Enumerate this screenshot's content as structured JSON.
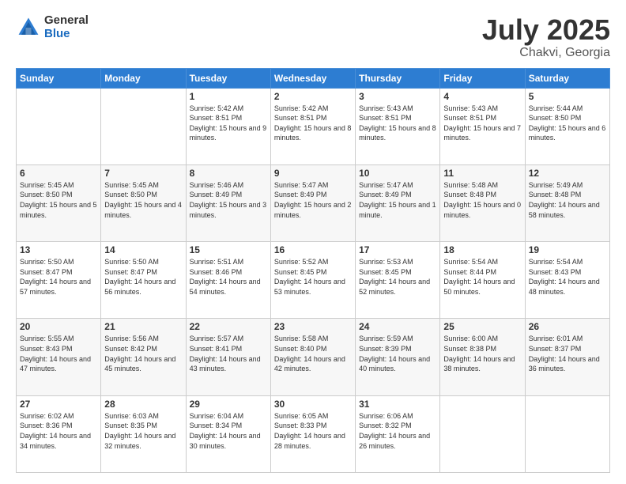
{
  "logo": {
    "general": "General",
    "blue": "Blue"
  },
  "header": {
    "month": "July 2025",
    "location": "Chakvi, Georgia"
  },
  "weekdays": [
    "Sunday",
    "Monday",
    "Tuesday",
    "Wednesday",
    "Thursday",
    "Friday",
    "Saturday"
  ],
  "weeks": [
    [
      {
        "day": "",
        "sunrise": "",
        "sunset": "",
        "daylight": ""
      },
      {
        "day": "",
        "sunrise": "",
        "sunset": "",
        "daylight": ""
      },
      {
        "day": "1",
        "sunrise": "Sunrise: 5:42 AM",
        "sunset": "Sunset: 8:51 PM",
        "daylight": "Daylight: 15 hours and 9 minutes."
      },
      {
        "day": "2",
        "sunrise": "Sunrise: 5:42 AM",
        "sunset": "Sunset: 8:51 PM",
        "daylight": "Daylight: 15 hours and 8 minutes."
      },
      {
        "day": "3",
        "sunrise": "Sunrise: 5:43 AM",
        "sunset": "Sunset: 8:51 PM",
        "daylight": "Daylight: 15 hours and 8 minutes."
      },
      {
        "day": "4",
        "sunrise": "Sunrise: 5:43 AM",
        "sunset": "Sunset: 8:51 PM",
        "daylight": "Daylight: 15 hours and 7 minutes."
      },
      {
        "day": "5",
        "sunrise": "Sunrise: 5:44 AM",
        "sunset": "Sunset: 8:50 PM",
        "daylight": "Daylight: 15 hours and 6 minutes."
      }
    ],
    [
      {
        "day": "6",
        "sunrise": "Sunrise: 5:45 AM",
        "sunset": "Sunset: 8:50 PM",
        "daylight": "Daylight: 15 hours and 5 minutes."
      },
      {
        "day": "7",
        "sunrise": "Sunrise: 5:45 AM",
        "sunset": "Sunset: 8:50 PM",
        "daylight": "Daylight: 15 hours and 4 minutes."
      },
      {
        "day": "8",
        "sunrise": "Sunrise: 5:46 AM",
        "sunset": "Sunset: 8:49 PM",
        "daylight": "Daylight: 15 hours and 3 minutes."
      },
      {
        "day": "9",
        "sunrise": "Sunrise: 5:47 AM",
        "sunset": "Sunset: 8:49 PM",
        "daylight": "Daylight: 15 hours and 2 minutes."
      },
      {
        "day": "10",
        "sunrise": "Sunrise: 5:47 AM",
        "sunset": "Sunset: 8:49 PM",
        "daylight": "Daylight: 15 hours and 1 minute."
      },
      {
        "day": "11",
        "sunrise": "Sunrise: 5:48 AM",
        "sunset": "Sunset: 8:48 PM",
        "daylight": "Daylight: 15 hours and 0 minutes."
      },
      {
        "day": "12",
        "sunrise": "Sunrise: 5:49 AM",
        "sunset": "Sunset: 8:48 PM",
        "daylight": "Daylight: 14 hours and 58 minutes."
      }
    ],
    [
      {
        "day": "13",
        "sunrise": "Sunrise: 5:50 AM",
        "sunset": "Sunset: 8:47 PM",
        "daylight": "Daylight: 14 hours and 57 minutes."
      },
      {
        "day": "14",
        "sunrise": "Sunrise: 5:50 AM",
        "sunset": "Sunset: 8:47 PM",
        "daylight": "Daylight: 14 hours and 56 minutes."
      },
      {
        "day": "15",
        "sunrise": "Sunrise: 5:51 AM",
        "sunset": "Sunset: 8:46 PM",
        "daylight": "Daylight: 14 hours and 54 minutes."
      },
      {
        "day": "16",
        "sunrise": "Sunrise: 5:52 AM",
        "sunset": "Sunset: 8:45 PM",
        "daylight": "Daylight: 14 hours and 53 minutes."
      },
      {
        "day": "17",
        "sunrise": "Sunrise: 5:53 AM",
        "sunset": "Sunset: 8:45 PM",
        "daylight": "Daylight: 14 hours and 52 minutes."
      },
      {
        "day": "18",
        "sunrise": "Sunrise: 5:54 AM",
        "sunset": "Sunset: 8:44 PM",
        "daylight": "Daylight: 14 hours and 50 minutes."
      },
      {
        "day": "19",
        "sunrise": "Sunrise: 5:54 AM",
        "sunset": "Sunset: 8:43 PM",
        "daylight": "Daylight: 14 hours and 48 minutes."
      }
    ],
    [
      {
        "day": "20",
        "sunrise": "Sunrise: 5:55 AM",
        "sunset": "Sunset: 8:43 PM",
        "daylight": "Daylight: 14 hours and 47 minutes."
      },
      {
        "day": "21",
        "sunrise": "Sunrise: 5:56 AM",
        "sunset": "Sunset: 8:42 PM",
        "daylight": "Daylight: 14 hours and 45 minutes."
      },
      {
        "day": "22",
        "sunrise": "Sunrise: 5:57 AM",
        "sunset": "Sunset: 8:41 PM",
        "daylight": "Daylight: 14 hours and 43 minutes."
      },
      {
        "day": "23",
        "sunrise": "Sunrise: 5:58 AM",
        "sunset": "Sunset: 8:40 PM",
        "daylight": "Daylight: 14 hours and 42 minutes."
      },
      {
        "day": "24",
        "sunrise": "Sunrise: 5:59 AM",
        "sunset": "Sunset: 8:39 PM",
        "daylight": "Daylight: 14 hours and 40 minutes."
      },
      {
        "day": "25",
        "sunrise": "Sunrise: 6:00 AM",
        "sunset": "Sunset: 8:38 PM",
        "daylight": "Daylight: 14 hours and 38 minutes."
      },
      {
        "day": "26",
        "sunrise": "Sunrise: 6:01 AM",
        "sunset": "Sunset: 8:37 PM",
        "daylight": "Daylight: 14 hours and 36 minutes."
      }
    ],
    [
      {
        "day": "27",
        "sunrise": "Sunrise: 6:02 AM",
        "sunset": "Sunset: 8:36 PM",
        "daylight": "Daylight: 14 hours and 34 minutes."
      },
      {
        "day": "28",
        "sunrise": "Sunrise: 6:03 AM",
        "sunset": "Sunset: 8:35 PM",
        "daylight": "Daylight: 14 hours and 32 minutes."
      },
      {
        "day": "29",
        "sunrise": "Sunrise: 6:04 AM",
        "sunset": "Sunset: 8:34 PM",
        "daylight": "Daylight: 14 hours and 30 minutes."
      },
      {
        "day": "30",
        "sunrise": "Sunrise: 6:05 AM",
        "sunset": "Sunset: 8:33 PM",
        "daylight": "Daylight: 14 hours and 28 minutes."
      },
      {
        "day": "31",
        "sunrise": "Sunrise: 6:06 AM",
        "sunset": "Sunset: 8:32 PM",
        "daylight": "Daylight: 14 hours and 26 minutes."
      },
      {
        "day": "",
        "sunrise": "",
        "sunset": "",
        "daylight": ""
      },
      {
        "day": "",
        "sunrise": "",
        "sunset": "",
        "daylight": ""
      }
    ]
  ]
}
